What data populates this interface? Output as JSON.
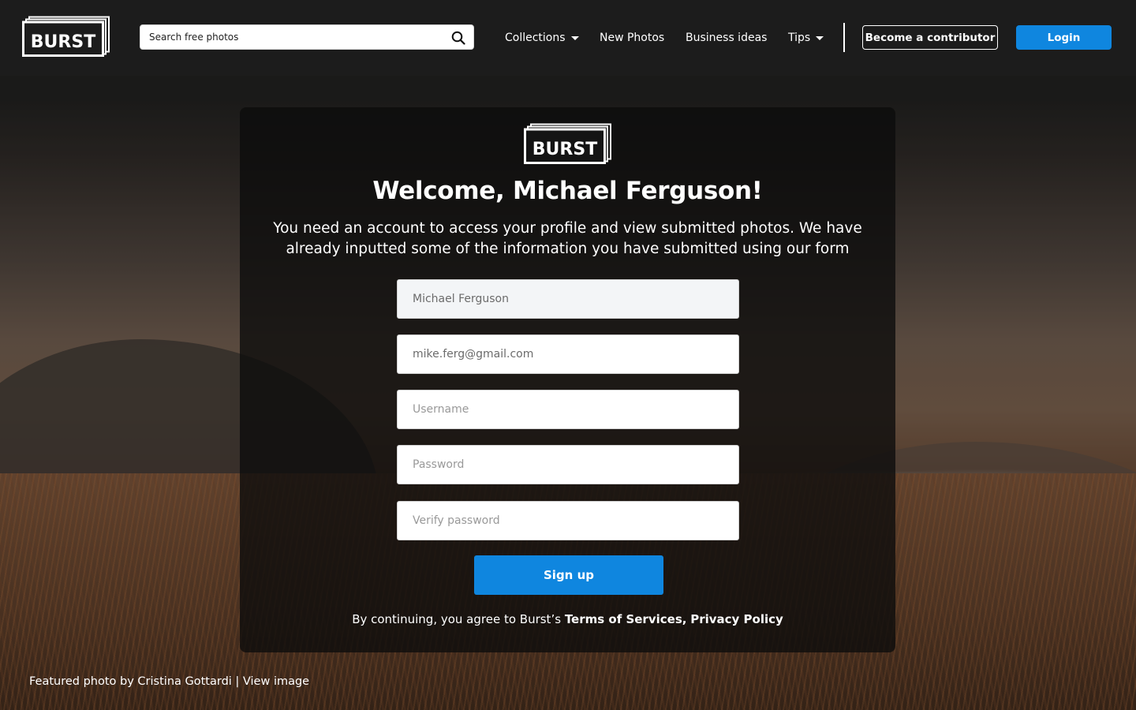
{
  "brand": {
    "logo_text": "BURST"
  },
  "header": {
    "search_placeholder": "Search free photos",
    "nav": {
      "collections": "Collections",
      "new_photos": "New Photos",
      "business_ideas": "Business ideas",
      "tips": "Tips"
    },
    "contributor_button": "Become a contributor",
    "login_button": "Login"
  },
  "card": {
    "title": "Welcome, Michael Ferguson!",
    "description": "You need an account to access your profile and view submitted photos. We have already inputted some of the information you have submitted using our form",
    "fields": {
      "name_value": "Michael Ferguson",
      "email_value": "mike.ferg@gmail.com",
      "username_placeholder": "Username",
      "password_placeholder": "Password",
      "verify_placeholder": "Verify password"
    },
    "signup_button": "Sign up",
    "terms_prefix": "By continuing, you agree to Burst’s",
    "terms_link": "Terms of Services,",
    "privacy_link": "Privacy Policy"
  },
  "footer": {
    "credit_text": "Featured photo by Cristina Gottardi",
    "separator": "|",
    "view_image": "View image"
  },
  "colors": {
    "accent": "#0f86df",
    "header_bg": "#1c1c1c"
  }
}
